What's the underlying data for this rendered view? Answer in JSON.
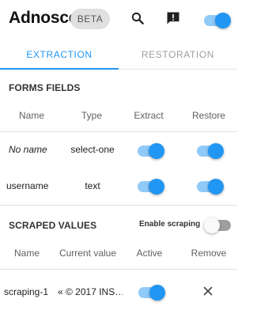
{
  "header": {
    "title": "Adnosco",
    "badge": "BETA",
    "search_icon": "search-icon",
    "feedback_icon": "feedback-icon",
    "main_toggle_on": true
  },
  "tabs": [
    {
      "label": "EXTRACTION",
      "active": true
    },
    {
      "label": "RESTORATION",
      "active": false
    }
  ],
  "forms_section": {
    "title": "FORMS FIELDS",
    "columns": [
      "Name",
      "Type",
      "Extract",
      "Restore"
    ],
    "rows": [
      {
        "name": "No name",
        "type": "select-one",
        "extract": true,
        "restore": true
      },
      {
        "name": "username",
        "type": "text",
        "extract": true,
        "restore": true
      }
    ]
  },
  "scraped_section": {
    "title": "SCRAPED VALUES",
    "enable_label": "Enable scraping",
    "enable_scraping": false,
    "columns": [
      "Name",
      "Current value",
      "Active",
      "Remove"
    ],
    "rows": [
      {
        "name": "scraping-1",
        "value": "« © 2017 INS…",
        "active": true,
        "remove_icon": "close-icon"
      }
    ]
  },
  "colors": {
    "accent": "#2196f3",
    "accent_light": "#90caf9",
    "muted": "#9e9e9e"
  }
}
